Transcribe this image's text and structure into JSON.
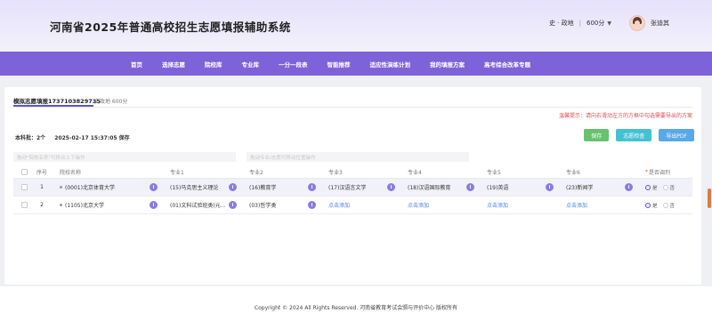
{
  "header": {
    "title": "河南省2025年普通高校招生志愿填报辅助系统",
    "subjects": "史 · 政地",
    "score": "600分",
    "username": "张迪其"
  },
  "nav": {
    "items": [
      "首页",
      "选择志愿",
      "院校库",
      "专业库",
      "一分一段表",
      "智能推荐",
      "适应性演练计划",
      "我的填报方案",
      "高考综合改革专题"
    ]
  },
  "main": {
    "tab_label": "模拟志愿填报1737103829735",
    "tab_sub": "史政地 600分",
    "tip": "温馨提示：请向右滑动左方的方框中勾选需要导出的方案",
    "batch_label": "本科批：2个",
    "timestamp": "2025-02-17 15:37:05 保存",
    "buttons": {
      "save": "保存",
      "check": "志愿检查",
      "export": "导出PDF"
    },
    "hint_left": "拖动\"院校名称\"可移动上下操作",
    "hint_right": "拖动专业/志愿可移动位置操作",
    "columns": [
      "序号",
      "院校名称",
      "专业1",
      "专业2",
      "专业3",
      "专业4",
      "专业5",
      "专业6",
      "是否调剂"
    ],
    "rows": [
      {
        "idx": "1",
        "school": "(0001)北京体育大学",
        "majors": [
          "(15)马克思主义理论",
          "(16)教育学",
          "(17)汉语言文学",
          "(18)汉语国际教育",
          "(19)英语",
          "(23)新闻学"
        ],
        "adjust_yes": "是",
        "adjust_no": "否"
      },
      {
        "idx": "2",
        "school": "(1105)北京大学",
        "majors": [
          "(01)文科试验班类(元…",
          "(03)哲学类",
          "点击添加",
          "点击添加",
          "点击添加",
          "点击添加"
        ],
        "adjust_yes": "是",
        "adjust_no": "否"
      }
    ]
  },
  "footer": {
    "text": "Copyright © 2024 All Rights Reserved. 河南省教育考试会颁与评价中心  版权所有"
  },
  "colors": {
    "nav": "#7d62d9",
    "accent": "#5b55d8",
    "save": "#67c26f",
    "check": "#45c1d4",
    "export": "#59a8e8",
    "tip": "#e24b4b"
  }
}
